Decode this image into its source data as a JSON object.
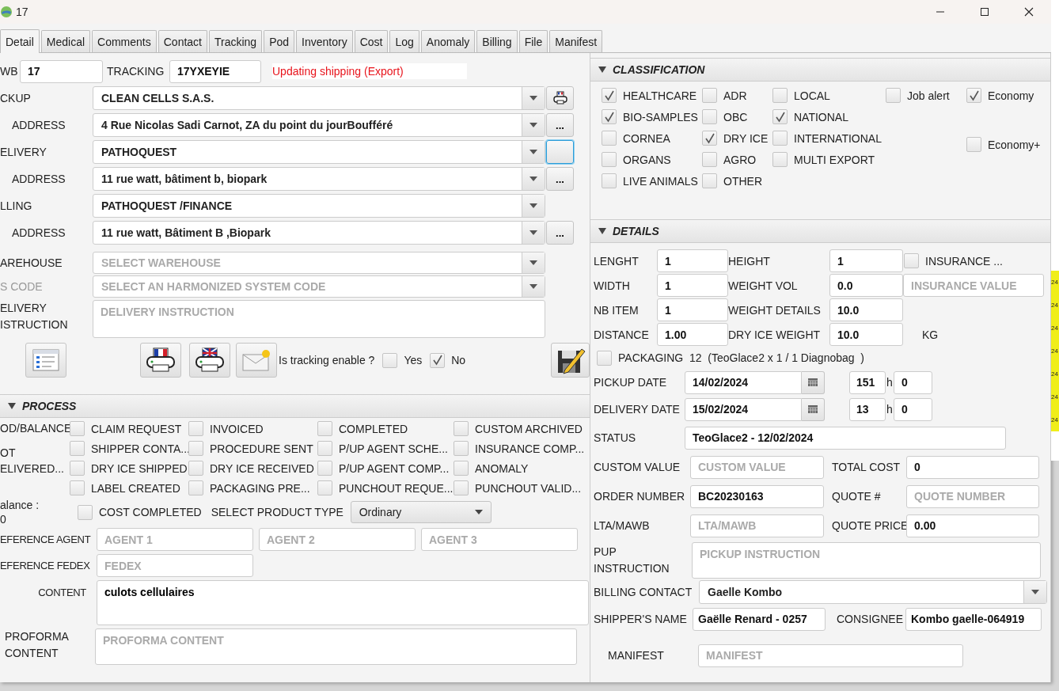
{
  "window": {
    "title": "17"
  },
  "tabs": [
    {
      "label": "Detail",
      "selected": true
    },
    {
      "label": "Medical",
      "selected": false
    },
    {
      "label": "Comments",
      "selected": false
    },
    {
      "label": "Contact",
      "selected": false
    },
    {
      "label": "Tracking",
      "selected": false
    },
    {
      "label": "Pod",
      "selected": false
    },
    {
      "label": "Inventory",
      "selected": false
    },
    {
      "label": "Cost",
      "selected": false
    },
    {
      "label": "Log",
      "selected": false
    },
    {
      "label": "Anomaly",
      "selected": false
    },
    {
      "label": "Billing",
      "selected": false
    },
    {
      "label": "File",
      "selected": false
    },
    {
      "label": "Manifest",
      "selected": false
    }
  ],
  "header": {
    "awb_label": "WB",
    "awb": "17",
    "tracking_label": "TRACKING",
    "tracking": "17YXEYIE",
    "status_message": "Updating shipping  (Export)"
  },
  "parties": [
    {
      "kind": "party",
      "label": "CKUP",
      "value": "CLEAN CELLS S.A.S.",
      "button": {
        "kind": "printer"
      }
    },
    {
      "kind": "address",
      "label": "ADDRESS",
      "value": "4 Rue Nicolas Sadi Carnot, ZA du point du jourBoufféré",
      "button": {
        "kind": "text",
        "label": "..."
      }
    },
    {
      "kind": "party",
      "label": "ELIVERY",
      "value": "PATHOQUEST",
      "button": {
        "kind": "blank",
        "focused": true
      }
    },
    {
      "kind": "address",
      "label": "ADDRESS",
      "value": "11 rue watt, bâtiment b, biopark",
      "button": {
        "kind": "text",
        "label": "..."
      }
    },
    {
      "kind": "party",
      "label": "LLING",
      "value": "PATHOQUEST /FINANCE"
    },
    {
      "kind": "address",
      "label": "ADDRESS",
      "value": "11 rue watt, Bâtiment B ,Biopark",
      "button": {
        "kind": "text",
        "label": "..."
      }
    }
  ],
  "selectors": [
    {
      "label": "AREHOUSE",
      "placeholder": "SELECT WAREHOUSE",
      "disabled": false
    },
    {
      "label": "S CODE",
      "placeholder": "SELECT AN HARMONIZED SYSTEM CODE",
      "disabled": true
    }
  ],
  "delivery_instruction": {
    "label": "ELIVERY ISTRUCTION",
    "placeholder": "DELIVERY INSTRUCTION"
  },
  "tracking_enable": {
    "question": "Is tracking enable ?",
    "options": [
      {
        "label": "Yes",
        "checked": false
      },
      {
        "label": "No",
        "checked": true
      }
    ]
  },
  "process": {
    "title": "PROCESS",
    "expanded": true,
    "side_labels": [
      "OD/BALANCE",
      "OT ELIVERED..."
    ],
    "columns": [
      [
        {
          "label": "CLAIM REQUEST",
          "checked": false
        },
        {
          "label": "SHIPPER CONTA...",
          "checked": false
        },
        {
          "label": "DRY ICE SHIPPED",
          "checked": false
        },
        {
          "label": "LABEL CREATED",
          "checked": false
        }
      ],
      [
        {
          "label": "INVOICED",
          "checked": false
        },
        {
          "label": "PROCEDURE SENT",
          "checked": false
        },
        {
          "label": "DRY ICE RECEIVED",
          "checked": false
        },
        {
          "label": "PACKAGING PRE...",
          "checked": false
        }
      ],
      [
        {
          "label": "COMPLETED",
          "checked": false
        },
        {
          "label": "P/UP AGENT SCHE...",
          "checked": false
        },
        {
          "label": "P/UP AGENT COMP...",
          "checked": false
        },
        {
          "label": "PUNCHOUT REQUE...",
          "checked": false
        }
      ],
      [
        {
          "label": "CUSTOM ARCHIVED",
          "checked": false
        },
        {
          "label": "INSURANCE COMP...",
          "checked": false
        },
        {
          "label": "ANOMALY",
          "checked": false
        },
        {
          "label": "PUNCHOUT VALID...",
          "checked": false
        }
      ]
    ],
    "balance_label": "alance :",
    "balance": "0",
    "cost_completed": {
      "label": "COST COMPLETED",
      "checked": false
    },
    "product_type": {
      "label": "SELECT PRODUCT TYPE",
      "value": "Ordinary"
    },
    "agents": {
      "label": "EFERENCE AGENT",
      "placeholders": [
        "AGENT 1",
        "AGENT 2",
        "AGENT 3"
      ]
    },
    "fedex": {
      "label": "EFERENCE FEDEX",
      "placeholder": "FEDEX"
    },
    "content": {
      "label": "CONTENT",
      "value": "culots cellulaires"
    },
    "proforma": {
      "label": "PROFORMA CONTENT",
      "placeholder": "PROFORMA CONTENT"
    }
  },
  "classification": {
    "title": "CLASSIFICATION",
    "expanded": true,
    "columns": [
      [
        {
          "label": "HEALTHCARE",
          "checked": true
        },
        {
          "label": "BIO-SAMPLES",
          "checked": true
        },
        {
          "label": "CORNEA",
          "checked": false
        },
        {
          "label": "ORGANS",
          "checked": false
        },
        {
          "label": "LIVE ANIMALS",
          "checked": false
        }
      ],
      [
        {
          "label": "ADR",
          "checked": false
        },
        {
          "label": "OBC",
          "checked": false
        },
        {
          "label": "DRY ICE",
          "checked": true
        },
        {
          "label": "AGRO",
          "checked": false
        },
        {
          "label": "OTHER",
          "checked": false
        }
      ],
      [
        {
          "label": "LOCAL",
          "checked": false
        },
        {
          "label": "NATIONAL",
          "checked": true
        },
        {
          "label": "INTERNATIONAL",
          "checked": false
        },
        {
          "label": "MULTI EXPORT",
          "checked": false
        }
      ],
      [
        {
          "label": "Job alert",
          "checked": false
        }
      ]
    ],
    "economy": [
      {
        "label": "Economy",
        "checked": true
      },
      {
        "label": "Economy+",
        "checked": false
      }
    ]
  },
  "details": {
    "title": "DETAILS",
    "expanded": true,
    "rows": [
      {
        "label": "LENGHT",
        "value": "1",
        "label_2": "HEIGHT",
        "value_2": "1"
      },
      {
        "label": "WIDTH",
        "value": "1",
        "label_2": "WEIGHT VOL",
        "value_2": "0.0"
      },
      {
        "label": "NB ITEM",
        "value": "1",
        "label_2": "WEIGHT DETAILS",
        "value_2": "10.0"
      },
      {
        "label": "DISTANCE",
        "value": "1.00",
        "label_2": "DRY ICE WEIGHT",
        "value_2": "10.0"
      }
    ],
    "insurance": {
      "label": "INSURANCE ...",
      "checked": false,
      "placeholder": "INSURANCE VALUE"
    },
    "unit": "KG",
    "packaging": {
      "checked": false,
      "text": "PACKAGING  12  (TeoGlace2 x 1 / 1 Diagnobag  )"
    },
    "dates": [
      {
        "label": "PICKUP DATE",
        "date": "14/02/2024",
        "hour": "151",
        "hour_unit": "h",
        "minute": "0"
      },
      {
        "label": "DELIVERY DATE",
        "date": "15/02/2024",
        "hour": "13",
        "hour_unit": "h",
        "minute": "0"
      }
    ],
    "status": {
      "label": "STATUS",
      "value": "TeoGlace2 - 12/02/2024"
    },
    "pairs": [
      [
        {
          "label": "CUSTOM VALUE",
          "placeholder": "CUSTOM VALUE"
        },
        {
          "label": "TOTAL COST",
          "value": "0"
        }
      ],
      [
        {
          "label": "ORDER NUMBER",
          "value": "BC20230163"
        },
        {
          "label": "QUOTE #",
          "placeholder": "QUOTE NUMBER"
        }
      ],
      [
        {
          "label": "LTA/MAWB",
          "placeholder": "LTA/MAWB"
        },
        {
          "label": "QUOTE PRICE",
          "value": "0.00"
        }
      ]
    ],
    "pup_instruction": {
      "label": "PUP INSTRUCTION",
      "placeholder": "PICKUP INSTRUCTION"
    },
    "billing_contact": {
      "label": "BILLING CONTACT",
      "value": "Gaelle Kombo"
    },
    "shipper": {
      "label": "SHIPPER'S NAME",
      "value": "Gaëlle Renard - 0257"
    },
    "consignee": {
      "label": "CONSIGNEE",
      "value": "Kombo gaelle-064919"
    },
    "manifest": {
      "label": "MANIFEST",
      "placeholder": "MANIFEST"
    }
  },
  "background_window": {
    "cells": [
      "24",
      "24",
      "24",
      "24",
      "24",
      "24",
      "24"
    ]
  }
}
